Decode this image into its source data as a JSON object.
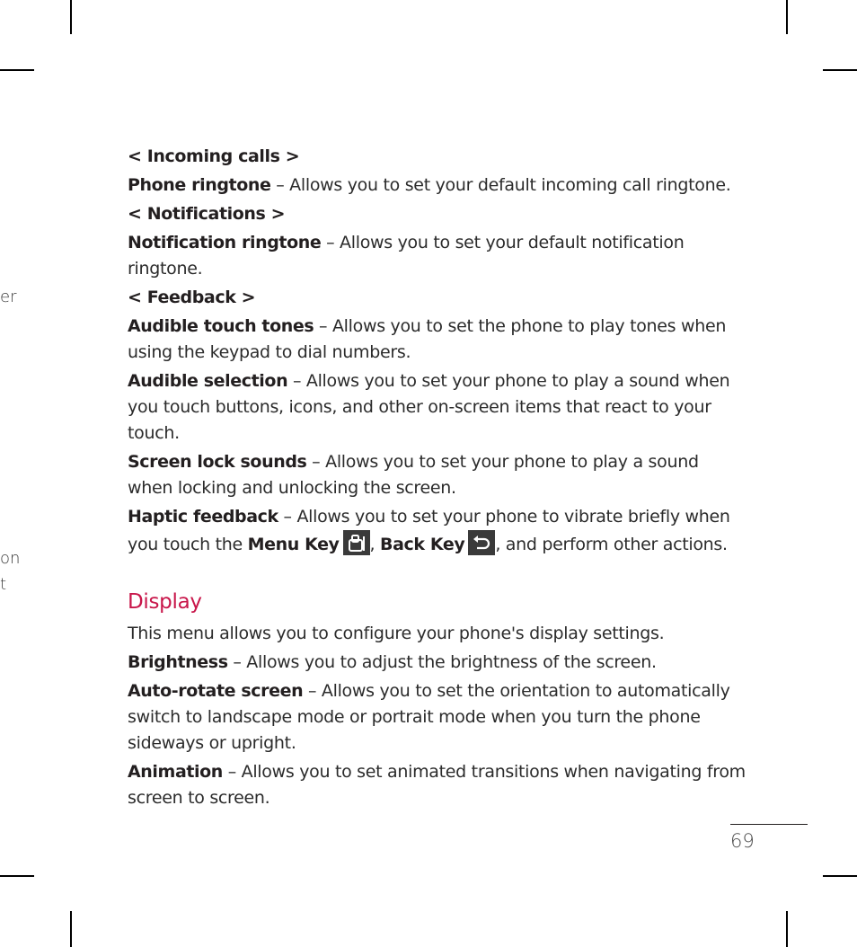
{
  "bleed_fragments": [
    "er",
    "on",
    "t"
  ],
  "sections": {
    "incoming_calls": {
      "header": "< Incoming calls >",
      "items": [
        {
          "term": "Phone ringtone",
          "desc": " – Allows you to set your default incoming call ringtone."
        }
      ]
    },
    "notifications": {
      "header": "< Notifications >",
      "items": [
        {
          "term": "Notification ringtone",
          "desc": " – Allows you to set your default notification ringtone."
        }
      ]
    },
    "feedback": {
      "header": "< Feedback >",
      "items": [
        {
          "term": "Audible touch tones",
          "desc": " – Allows you to set the phone to play tones when using the keypad to dial numbers."
        },
        {
          "term": "Audible selection",
          "desc": " – Allows you to set your phone to play a sound when you touch buttons, icons, and other on-screen items that react to your touch."
        },
        {
          "term": "Screen lock sounds",
          "desc": " – Allows you to set your phone to play a sound when locking and unlocking the screen."
        }
      ],
      "haptic": {
        "term": "Haptic feedback",
        "desc_a": " – Allows you to set your phone to vibrate briefly when you touch the ",
        "menu_key": "Menu Key",
        "sep": ", ",
        "back_key": "Back Key",
        "desc_b": ", and perform other actions.",
        "menu_icon": "menu-key-icon",
        "back_icon": "back-key-icon"
      }
    },
    "display": {
      "title": "Display",
      "title_color": "#c8164a",
      "intro": "This menu allows you to configure your phone's display settings.",
      "items": [
        {
          "term": "Brightness",
          "desc": " – Allows you to adjust the brightness of the screen."
        },
        {
          "term": "Auto-rotate screen",
          "desc": " – Allows you to set the orientation to automatically switch to landscape mode or portrait mode when you turn the phone sideways or upright."
        },
        {
          "term": "Animation",
          "desc": " – Allows you to set animated transitions when navigating from screen to screen."
        }
      ]
    }
  },
  "page_number": "69"
}
